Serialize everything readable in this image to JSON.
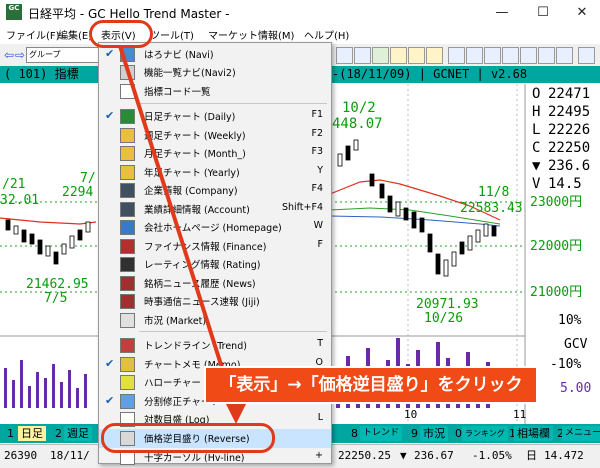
{
  "window": {
    "title": "日経平均 - GC Hello Trend Master -",
    "icon_text": "GC",
    "controls": [
      "—",
      "☐",
      "✕"
    ]
  },
  "menubar": [
    "ファイル(F)",
    "編集(E)",
    "表示(V)",
    "ツール(T)",
    "マーケット情報(M)",
    "ヘルプ(H)"
  ],
  "toolbar": {
    "search_placeholder": "グループ"
  },
  "infobar": {
    "text": "( 101) 指標",
    "right": "-(18/11/09) | GCNET | v2.68"
  },
  "ohlc": [
    {
      "label": "O",
      "value": "22471"
    },
    {
      "label": "H",
      "value": "22495"
    },
    {
      "label": "L",
      "value": "22226"
    },
    {
      "label": "C",
      "value": "22250"
    },
    {
      "label": "▼",
      "value": "236.6"
    },
    {
      "label": "V",
      "value": "14.5"
    }
  ],
  "chart": {
    "left_labels": [
      "/21",
      "32.01",
      "2294",
      "7/",
      "21462.95",
      "7/5"
    ],
    "mid_labels": [
      "10/2",
      "448.07"
    ],
    "right_labels": [
      "11/8",
      "22583.43",
      "20971.93",
      "10/26"
    ],
    "price_axis": [
      "23000円",
      "22000円",
      "21000円"
    ],
    "indicator_axis": [
      "10%",
      "GCV",
      "-10%",
      "5.00"
    ],
    "month_labels": [
      "10",
      "11"
    ],
    "line_colors": {
      "price_ma": "#e03020",
      "ma2": "#2a9f2a",
      "ma3": "#3060c0",
      "bars": "#6a2aa8"
    }
  },
  "tabs": [
    "1",
    "日足",
    "2",
    "週足",
    "8",
    "トレンド",
    "9",
    "市況",
    "0",
    "ランキング",
    "1",
    "相場欄",
    "2",
    "メニュー"
  ],
  "status": [
    "26390",
    "18/11/",
    "22250.25",
    "▼",
    "236.67",
    "-1.05%",
    "日",
    "14.472"
  ],
  "dropdown": {
    "items": [
      {
        "label": "はろナビ (Navi)",
        "key": "",
        "checked": true,
        "icon_color": "#4a8ad0"
      },
      {
        "label": "機能一覧ナビ(Navi2)",
        "key": "",
        "checked": false,
        "icon_color": "#d0d0d0"
      },
      {
        "label": "指標コード一覧",
        "key": "",
        "checked": false,
        "icon_color": "#ffffff"
      },
      {
        "label": "日足チャート (Daily)",
        "key": "F1",
        "checked": true,
        "icon_color": "#2a8a3a"
      },
      {
        "label": "週足チャート (Weekly)",
        "key": "F2",
        "checked": false,
        "icon_color": "#e8c040"
      },
      {
        "label": "月足チャート (Month_)",
        "key": "F3",
        "checked": false,
        "icon_color": "#e8c040"
      },
      {
        "label": "年足チャート (Yearly)",
        "key": "Y",
        "checked": false,
        "icon_color": "#e8c040"
      },
      {
        "label": "企業情報 (Company)",
        "key": "F4",
        "checked": false,
        "icon_color": "#405060"
      },
      {
        "label": "業績詳細情報 (Account)",
        "key": "Shift+F4",
        "checked": false,
        "icon_color": "#405060"
      },
      {
        "label": "会社ホームページ (Homepage)",
        "key": "W",
        "checked": false,
        "icon_color": "#3a78c8"
      },
      {
        "label": "ファイナンス情報 (Finance)",
        "key": "F",
        "checked": false,
        "icon_color": "#b03030"
      },
      {
        "label": "レーティング情報 (Rating)",
        "key": "",
        "checked": false,
        "icon_color": "#303030"
      },
      {
        "label": "銘柄ニュース履歴 (News)",
        "key": "",
        "checked": false,
        "icon_color": "#a03030"
      },
      {
        "label": "時事通信ニュース速報 (Jiji)",
        "key": "",
        "checked": false,
        "icon_color": "#a03030"
      },
      {
        "label": "市況 (Market)",
        "key": "",
        "checked": false,
        "icon_color": "#e0e0e0"
      },
      {
        "label": "トレンドライン (Trend)",
        "key": "T",
        "checked": false,
        "icon_color": "#c04040"
      },
      {
        "label": "チャートメモ (Memo)",
        "key": "O",
        "checked": true,
        "icon_color": "#e0c040"
      },
      {
        "label": "ハローチャートメモ",
        "key": "",
        "checked": false,
        "icon_color": "#e0e040"
      },
      {
        "label": "分割修正チャート",
        "key": "",
        "checked": true,
        "icon_color": "#60a0e0"
      },
      {
        "label": "対数目盛 (Log)",
        "key": "L",
        "checked": false,
        "icon_color": "#ffffff"
      },
      {
        "label": "価格逆目盛り (Reverse)",
        "key": "",
        "checked": false,
        "icon_color": "#d8d8d8"
      },
      {
        "label": "十字カーソル (Hv-line)",
        "key": "+",
        "checked": false,
        "icon_color": "#ffffff"
      }
    ]
  },
  "annotation": {
    "callout_text": "「表示」→「価格逆目盛り」をクリック",
    "color": "#f04a16"
  }
}
